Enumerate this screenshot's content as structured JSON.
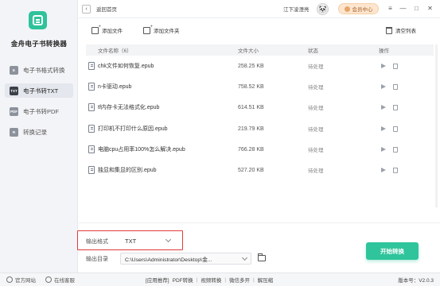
{
  "app": {
    "title": "金舟电子书转换器"
  },
  "sidebar": {
    "items": [
      {
        "label": "电子书格式转换",
        "icon": "E"
      },
      {
        "label": "电子书转TXT",
        "icon": "TXT"
      },
      {
        "label": "电子书转PDF",
        "icon": "PDF"
      },
      {
        "label": "转换记录",
        "icon": "R"
      }
    ],
    "active_index": 1
  },
  "header": {
    "back_label": "返回首页",
    "user_name": "江下凌澄亮",
    "vip_label": "会员中心",
    "window": {
      "menu": "≡",
      "minimize": "—",
      "maximize": "□",
      "close": "✕"
    }
  },
  "toolbar": {
    "add_file": "添加文件",
    "add_folder": "添加文件夹",
    "clear_list": "清空列表"
  },
  "table": {
    "headers": {
      "name": "文件名称（6）",
      "size": "文件大小",
      "status": "状态",
      "action": "操作"
    },
    "rows": [
      {
        "name": "chk文件如何恢复.epub",
        "size": "258.25 KB",
        "status": "待处理"
      },
      {
        "name": "n卡驱动.epub",
        "size": "758.52 KB",
        "status": "待处理"
      },
      {
        "name": "tf内存卡无法格式化.epub",
        "size": "614.51 KB",
        "status": "待处理"
      },
      {
        "name": "打印机不打印什么原因.epub",
        "size": "219.79 KB",
        "status": "待处理"
      },
      {
        "name": "电脑cpu占用率100%怎么解决.epub",
        "size": "766.28 KB",
        "status": "待处理"
      },
      {
        "name": "独显和集显的区别.epub",
        "size": "527.20 KB",
        "status": "待处理"
      }
    ]
  },
  "bottom": {
    "format_label": "输出格式",
    "format_value": "TXT",
    "dir_label": "输出目录",
    "dir_value": "C:\\Users\\Administrator\\Desktop\\金...",
    "start_label": "开始转换"
  },
  "footer": {
    "website": "官方网站",
    "service": "在线客服",
    "links": [
      "[应用推荐]",
      "PDF转换",
      "视频转换",
      "微信多开",
      "解压缩"
    ],
    "version": "版本号：V2.0.3"
  },
  "colors": {
    "accent": "#2fc49c",
    "highlight": "#e03a3a",
    "vip": "#fde6cf"
  }
}
